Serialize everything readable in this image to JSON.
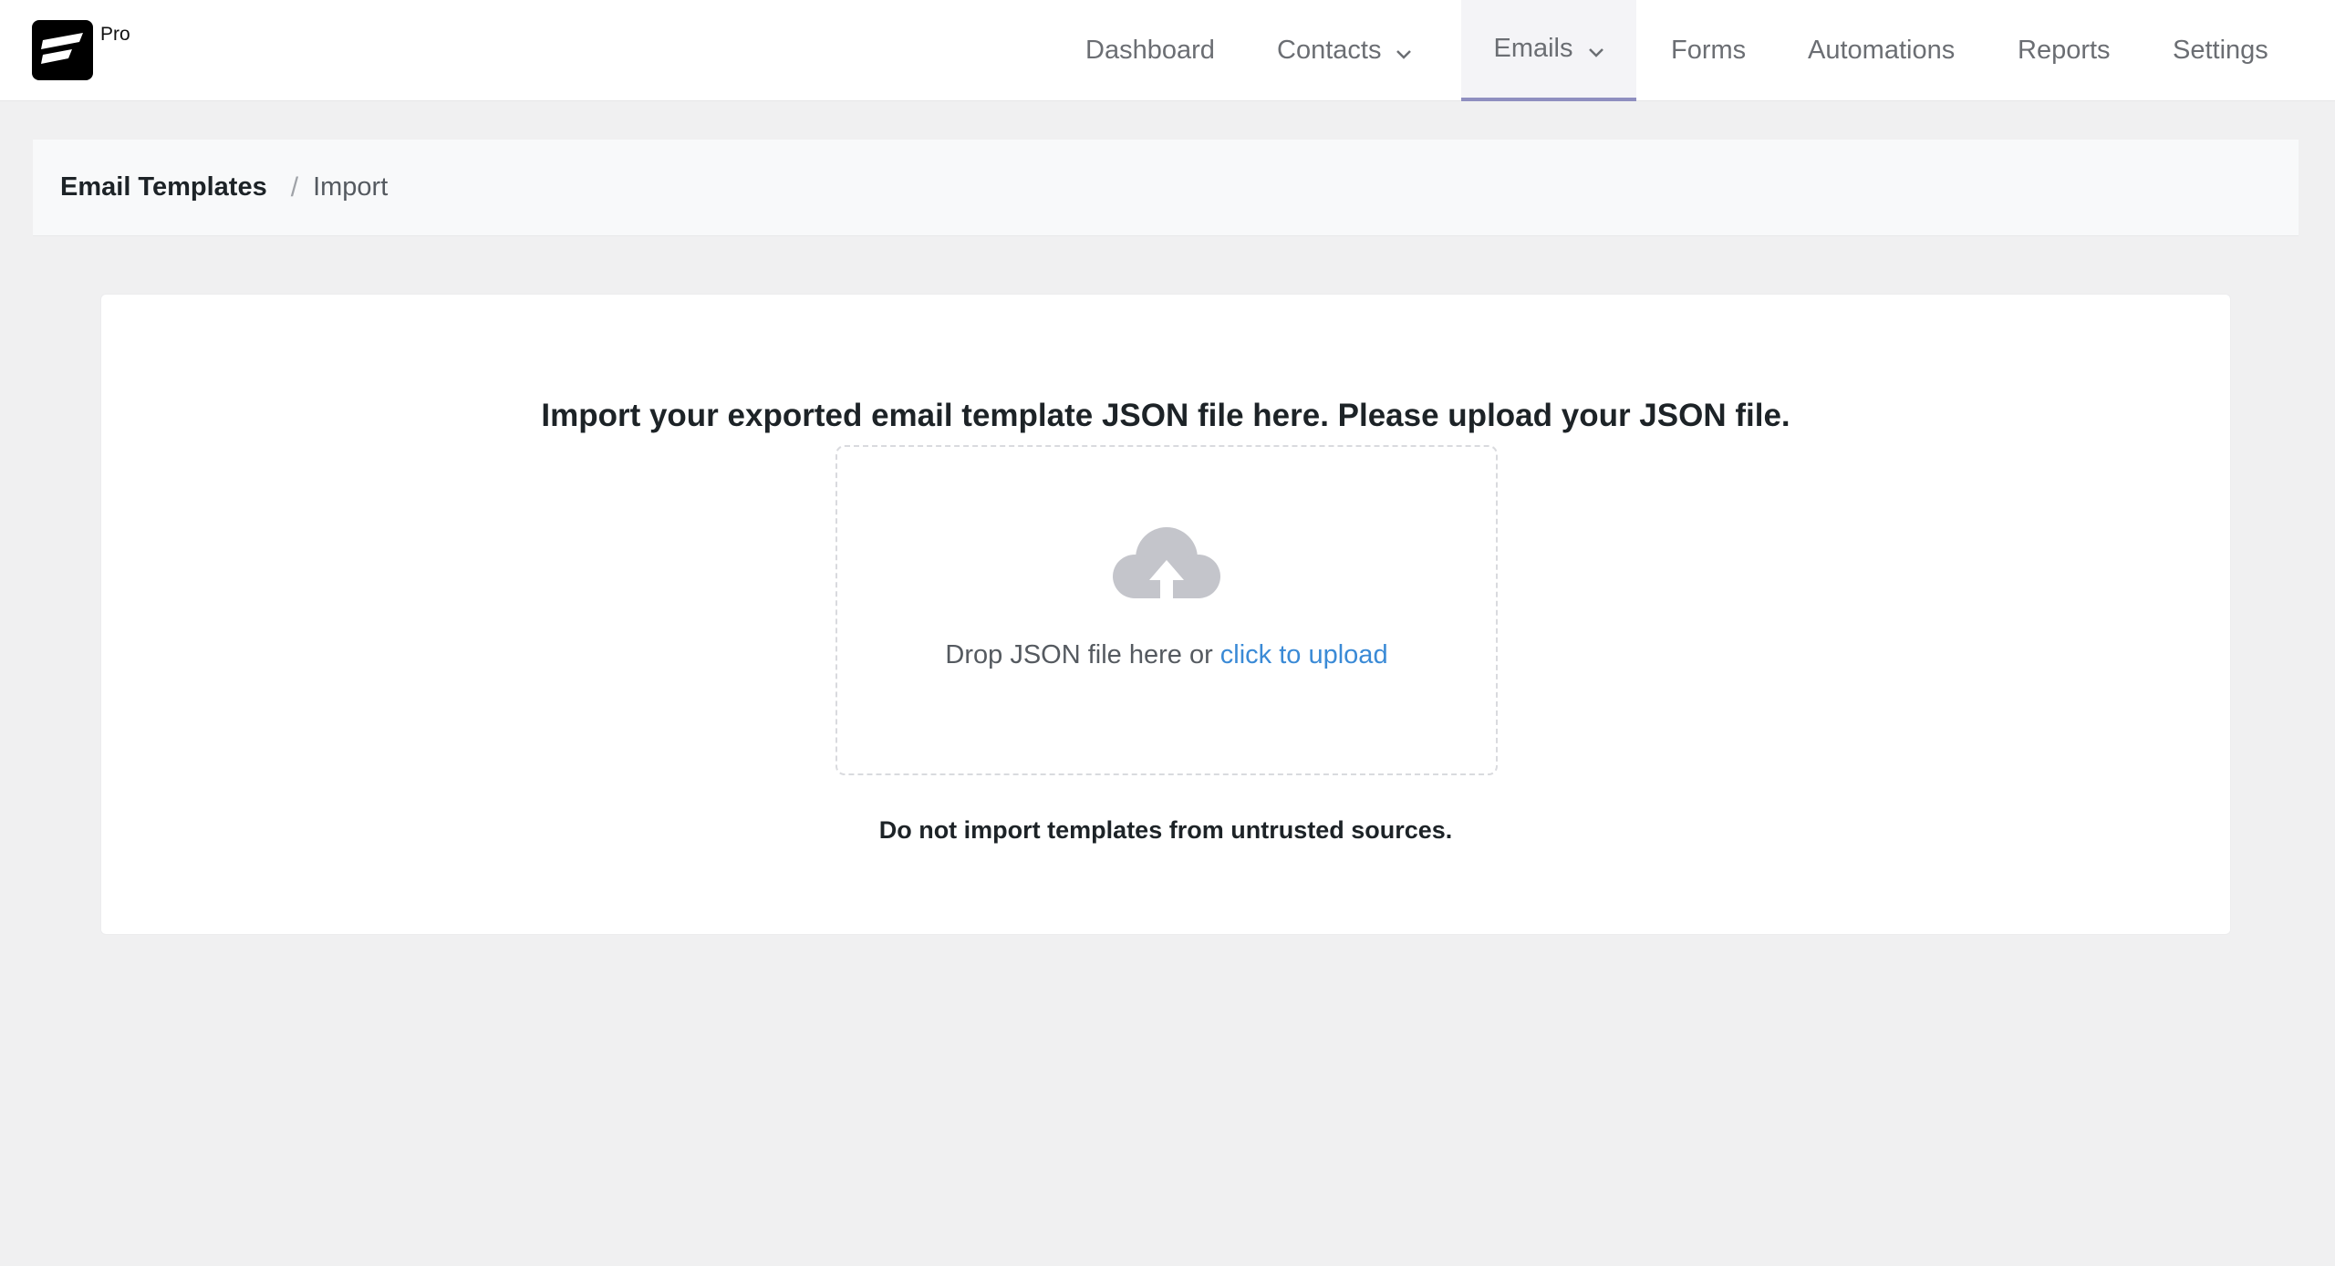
{
  "app": {
    "logo_badge": "Pro",
    "colors": {
      "accent_underline": "#8f8fc0",
      "link": "#3a8ad6",
      "icon_gray": "#c4c5cb"
    }
  },
  "nav": {
    "items": [
      {
        "label": "Dashboard",
        "has_dropdown": false,
        "active": false
      },
      {
        "label": "Contacts",
        "has_dropdown": true,
        "active": false
      },
      {
        "label": "Emails",
        "has_dropdown": true,
        "active": true
      },
      {
        "label": "Forms",
        "has_dropdown": false,
        "active": false
      },
      {
        "label": "Automations",
        "has_dropdown": false,
        "active": false
      },
      {
        "label": "Reports",
        "has_dropdown": false,
        "active": false
      },
      {
        "label": "Settings",
        "has_dropdown": false,
        "active": false
      }
    ]
  },
  "breadcrumb": {
    "parent": "Email Templates",
    "separator": "/",
    "current": "Import"
  },
  "import": {
    "heading": "Import your exported email template JSON file here. Please upload your JSON file.",
    "drop_text": "Drop JSON file here or",
    "upload_link": "click to upload",
    "upload_icon": "cloud-upload-icon",
    "warning": "Do not import templates from untrusted sources."
  }
}
